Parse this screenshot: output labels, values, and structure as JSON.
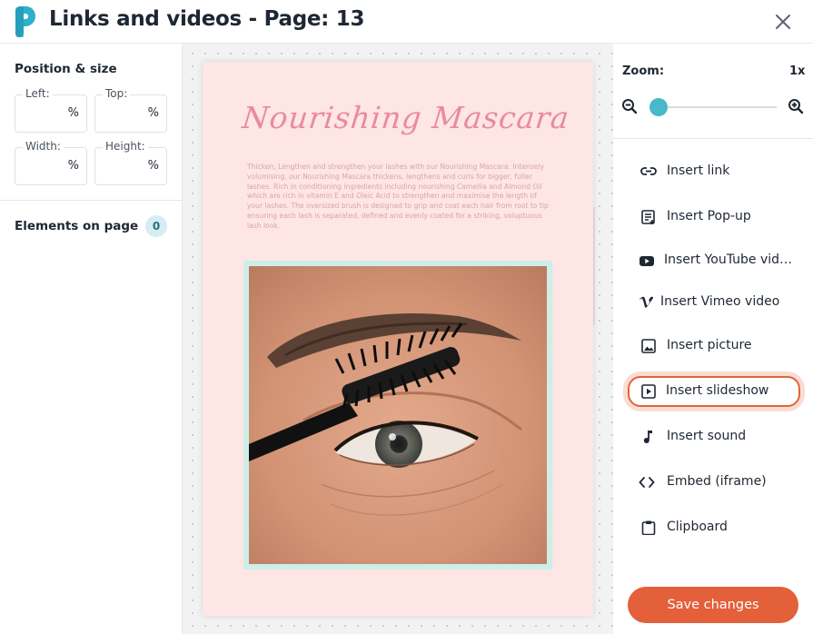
{
  "header": {
    "title": "Links and videos - Page: 13"
  },
  "left_panel": {
    "position_title": "Position & size",
    "fields": {
      "left": {
        "label": "Left:",
        "value": "",
        "unit": "%"
      },
      "top": {
        "label": "Top:",
        "value": "",
        "unit": "%"
      },
      "width": {
        "label": "Width:",
        "value": "",
        "unit": "%"
      },
      "height": {
        "label": "Height:",
        "value": "",
        "unit": "%"
      }
    },
    "elements_title": "Elements on page",
    "elements_count": "0"
  },
  "page_preview": {
    "title": "Nourishing Mascara",
    "body": "Thicken, Lengthen and strengthen your lashes with our Nourishing Mascara. Intensely volumising, our Nourishing Mascara thickens, lengthens and curls for bigger, fuller lashes. Rich in conditioning ingredients including nourishing Camellia and Almond Oil which are rich in vitamin E and Oleic Acid to strengthen and maximise the length of your lashes. The oversized brush is designed to grip and coat each hair from root to tip ensuring each lash is separated, defined and evenly coated for a striking, voluptuous lash look."
  },
  "zoom": {
    "label": "Zoom:",
    "value": "1x",
    "level": 0.0
  },
  "menu": [
    {
      "label": "Insert link",
      "icon": "link-icon"
    },
    {
      "label": "Insert Pop-up",
      "icon": "popup-icon"
    },
    {
      "label": "Insert YouTube video",
      "icon": "youtube-icon"
    },
    {
      "label": "Insert Vimeo video",
      "icon": "vimeo-icon"
    },
    {
      "label": "Insert picture",
      "icon": "picture-icon"
    },
    {
      "label": "Insert slideshow",
      "icon": "slideshow-icon"
    },
    {
      "label": "Insert sound",
      "icon": "music-note-icon"
    },
    {
      "label": "Embed (iframe)",
      "icon": "code-icon"
    },
    {
      "label": "Clipboard",
      "icon": "clipboard-icon"
    }
  ],
  "save_label": "Save changes",
  "colors": {
    "accent": "#e4603a",
    "brand_teal": "#49b9c9",
    "page_background": "#fde6e4",
    "script_pink": "#e98aa2"
  }
}
